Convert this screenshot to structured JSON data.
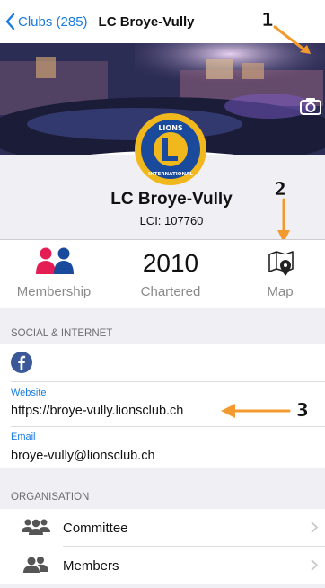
{
  "nav": {
    "back_label": "Clubs (285)",
    "title": "LC Broye-Vully"
  },
  "annotations": [
    "1",
    "2",
    "3"
  ],
  "club": {
    "name": "LC Broye-Vully",
    "lci": "LCI: 107760"
  },
  "stats": {
    "membership_label": "Membership",
    "year": "2010",
    "chartered_label": "Chartered",
    "map_label": "Map"
  },
  "social": {
    "heading": "SOCIAL & INTERNET",
    "website_label": "Website",
    "website_value": "https://broye-vully.lionsclub.ch",
    "email_label": "Email",
    "email_value": "broye-vully@lionsclub.ch"
  },
  "organisation": {
    "heading": "ORGANISATION",
    "items": [
      {
        "label": "Committee"
      },
      {
        "label": "Members"
      }
    ]
  },
  "colors": {
    "accent": "#1a7be0",
    "annotation_arrow": "#f39a2e",
    "facebook": "#3b5998",
    "lions_gold": "#f1b81e",
    "lions_blue": "#1a4a9c"
  },
  "icons": [
    "chevron-left-icon",
    "camera-icon",
    "lions-logo",
    "membership-icon",
    "map-icon",
    "facebook-icon",
    "committee-icon",
    "members-icon",
    "chevron-right-icon"
  ]
}
